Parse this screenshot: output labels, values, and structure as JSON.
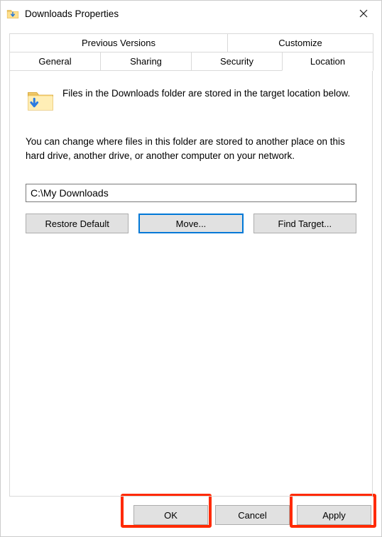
{
  "window": {
    "title": "Downloads Properties"
  },
  "tabs": {
    "row1": [
      {
        "label": "Previous Versions"
      },
      {
        "label": "Customize"
      }
    ],
    "row2": [
      {
        "label": "General"
      },
      {
        "label": "Sharing"
      },
      {
        "label": "Security"
      },
      {
        "label": "Location",
        "active": true
      }
    ]
  },
  "content": {
    "desc1": "Files in the Downloads folder are stored in the target location below.",
    "desc2": "You can change where files in this folder are stored to another place on this hard drive, another drive, or another computer on your network.",
    "path_value": "C:\\My Downloads",
    "restore_label": "Restore Default",
    "move_label": "Move...",
    "find_label": "Find Target..."
  },
  "footer": {
    "ok": "OK",
    "cancel": "Cancel",
    "apply": "Apply"
  }
}
